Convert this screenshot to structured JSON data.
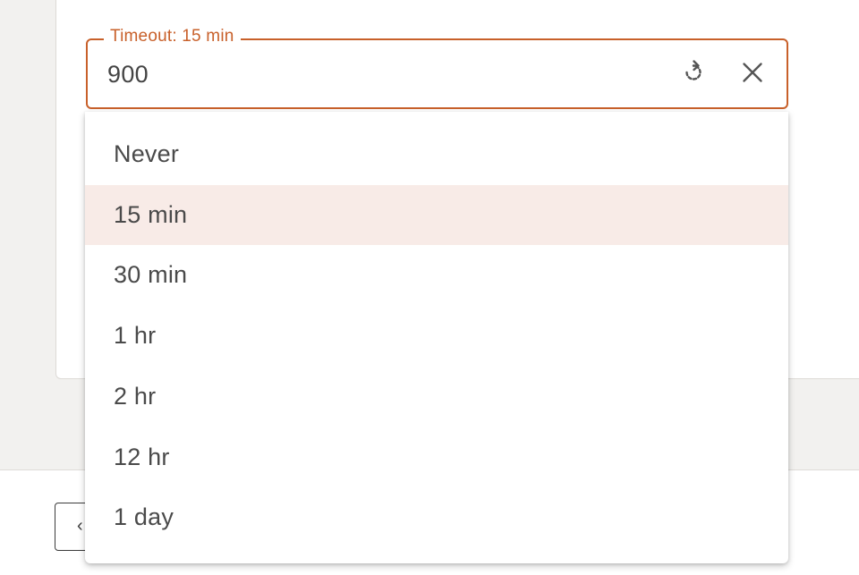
{
  "field": {
    "label": "Timeout: 15 min",
    "value": "900",
    "reset_icon": "reset-icon",
    "clear_icon": "close-icon"
  },
  "options": [
    {
      "label": "Never",
      "selected": false
    },
    {
      "label": "15 min",
      "selected": true
    },
    {
      "label": "30 min",
      "selected": false
    },
    {
      "label": "1 hr",
      "selected": false
    },
    {
      "label": "2 hr",
      "selected": false
    },
    {
      "label": "12 hr",
      "selected": false
    },
    {
      "label": "1 day",
      "selected": false
    }
  ],
  "footer": {
    "back_icon": "chevron-left-icon"
  },
  "colors": {
    "accent": "#c8602a",
    "selected_bg": "#f8ebe7",
    "text": "#4a4a4a"
  }
}
